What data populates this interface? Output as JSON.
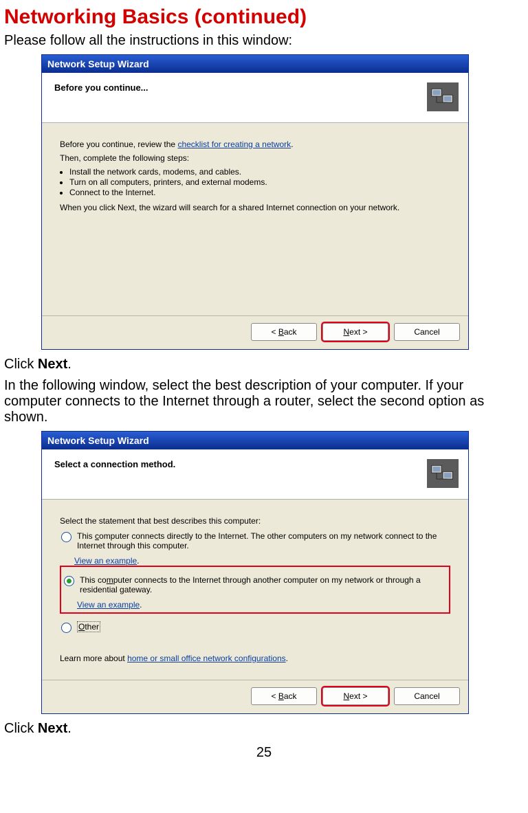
{
  "page": {
    "title": "Networking Basics (continued)",
    "intro": "Please follow all the instructions in this window:",
    "click_next_1": "Click ",
    "next_bold_1": "Next",
    "period_1": ".",
    "mid_text": "In the following window, select the best description of your computer. If your computer connects to the Internet through a router, select the second option as shown.",
    "click_next_2": "Click ",
    "next_bold_2": "Next",
    "period_2": ".",
    "page_number": "25"
  },
  "wizard1": {
    "title": "Network Setup Wizard",
    "header": "Before you continue...",
    "line_before_link": "Before you continue, review the ",
    "link": "checklist for creating a network",
    "after_link": ".",
    "steps_label": "Then, complete the following steps:",
    "step1": "Install the network cards, modems, and cables.",
    "step2": "Turn on all computers, printers, and external modems.",
    "step3": "Connect to the Internet.",
    "footer_line": "When you click Next, the wizard will search for a shared Internet connection on your network.",
    "btn_back": "< Back",
    "btn_next": "Next >",
    "btn_cancel": "Cancel"
  },
  "wizard2": {
    "title": "Network Setup Wizard",
    "header": "Select a connection method.",
    "prompt": "Select the statement that best describes this computer:",
    "opt1_a": "This ",
    "opt1_u": "c",
    "opt1_b": "omputer connects directly to the Internet. The other computers on my network connect to the Internet through this computer.",
    "view_example": "View an example",
    "opt2_a": "This co",
    "opt2_u": "m",
    "opt2_b": "puter connects to the Internet through another computer on my network or through a residential gateway.",
    "opt3_u": "O",
    "opt3_b": "ther",
    "learn_more_before": "Learn more about ",
    "learn_more_link": "home or small office network configurations",
    "learn_more_after": ".",
    "btn_back": "< Back",
    "btn_next": "Next >",
    "btn_cancel": "Cancel"
  }
}
